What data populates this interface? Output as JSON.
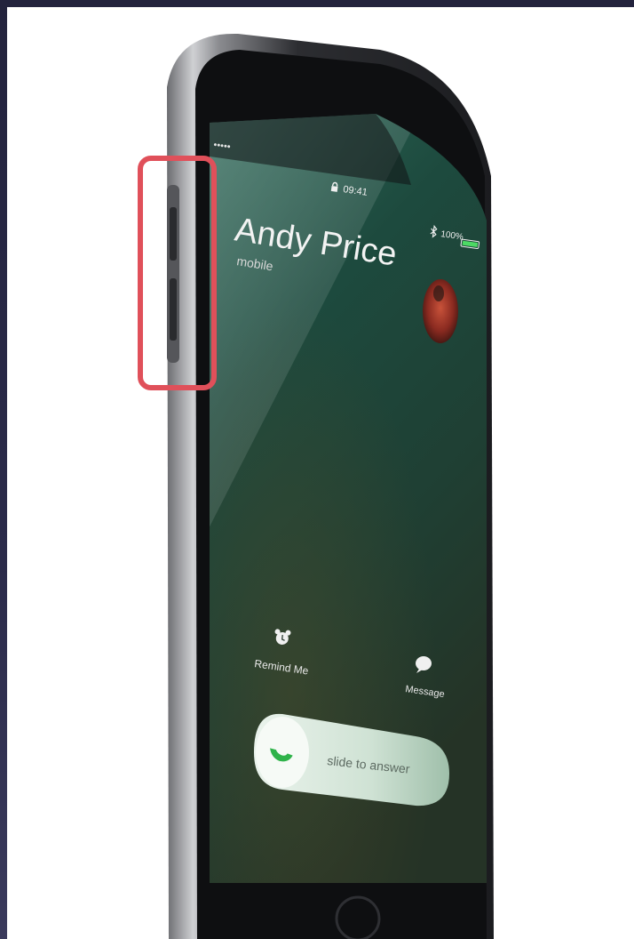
{
  "status_bar": {
    "carrier_signal": "••••• ",
    "time": "09:41",
    "battery": "100%"
  },
  "call": {
    "caller_name": "Andy Price",
    "caller_type": "mobile"
  },
  "actions": {
    "remind_label": "Remind Me",
    "message_label": "Message"
  },
  "slider": {
    "label": "slide to answer"
  },
  "colors": {
    "highlight_box": "#e0505a",
    "phone_body": "#3a3b3f",
    "screen_green": "#1f4a3e",
    "answer_green": "#2fb34a"
  },
  "icons": {
    "remind": "alarm-clock-icon",
    "message": "speech-bubble-icon",
    "answer": "phone-handset-icon",
    "lock": "lock-icon",
    "bluetooth": "bluetooth-icon",
    "battery": "battery-icon"
  }
}
